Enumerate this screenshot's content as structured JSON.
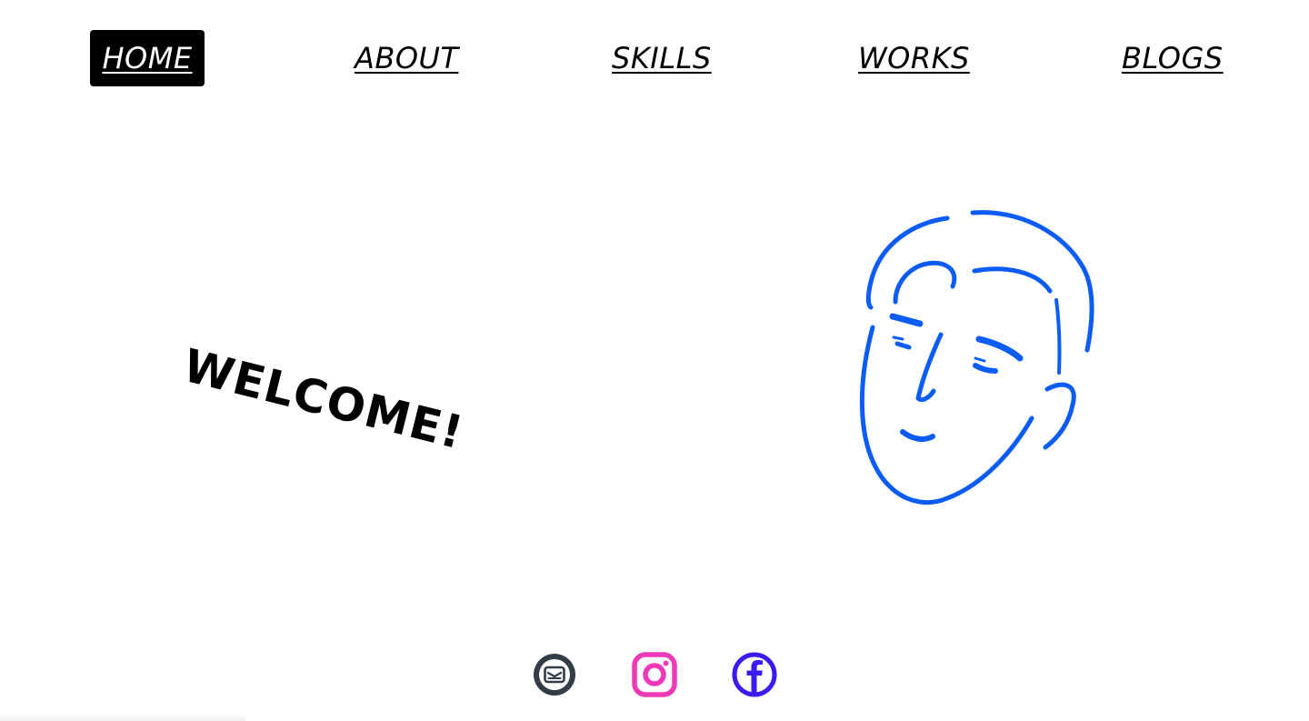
{
  "nav": {
    "items": [
      {
        "label": "HOME",
        "active": true
      },
      {
        "label": "ABOUT",
        "active": false
      },
      {
        "label": "SKILLS",
        "active": false
      },
      {
        "label": "WORKS",
        "active": false
      },
      {
        "label": "BLOGS",
        "active": false
      }
    ]
  },
  "hero": {
    "welcome_text": "WELCOME!",
    "portrait_icon": "face-line-drawing-icon",
    "portrait_color": "#0a5cf5"
  },
  "social": {
    "icons": [
      {
        "name": "mail-icon",
        "color": "#333d47"
      },
      {
        "name": "instagram-icon",
        "color": "#ee3ab8"
      },
      {
        "name": "facebook-icon",
        "color": "#3a1cf0"
      }
    ]
  }
}
